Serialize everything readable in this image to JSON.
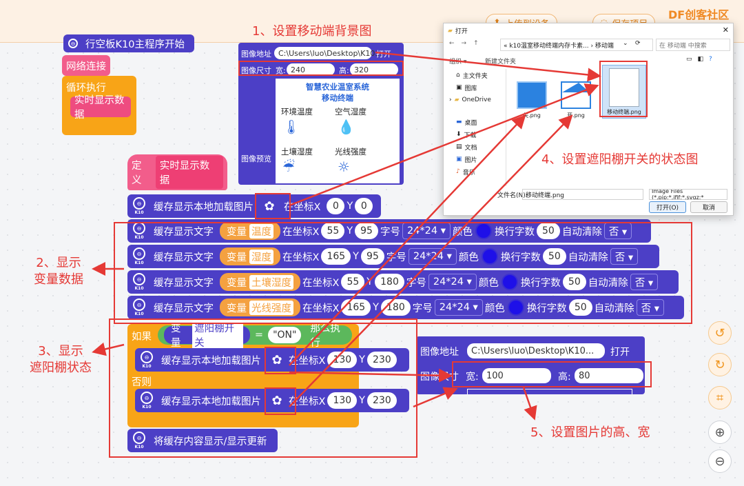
{
  "top_bar": {
    "button_1": "上传到设备",
    "button_2": "保存项目",
    "logo": "DF创客社区"
  },
  "blocks_top": {
    "start_block": "行空板K10主程序开始",
    "network": "网络连接",
    "loop": "循环执行",
    "call_fn": "实时显示数据"
  },
  "define_block": {
    "label": "定义",
    "name": "实时显示数据"
  },
  "load_image_block": {
    "text": "缓存显示本地加载图片",
    "at": "在坐标X",
    "x": "0",
    "y_label": "Y",
    "y": "0"
  },
  "text_blocks": [
    {
      "text": "缓存显示文字",
      "var_label": "变量",
      "var_name": "温度",
      "at": "在坐标X",
      "x": "55",
      "y_label": "Y",
      "y": "95",
      "size_label": "字号",
      "size": "24*24 ▾",
      "color_label": "颜色",
      "wrap_label": "换行字数",
      "wrap": "50",
      "clear_label": "自动清除",
      "clear": "否 ▾"
    },
    {
      "text": "缓存显示文字",
      "var_label": "变量",
      "var_name": "湿度",
      "at": "在坐标X",
      "x": "165",
      "y_label": "Y",
      "y": "95",
      "size_label": "字号",
      "size": "24*24 ▾",
      "color_label": "颜色",
      "wrap_label": "换行字数",
      "wrap": "50",
      "clear_label": "自动清除",
      "clear": "否 ▾"
    },
    {
      "text": "缓存显示文字",
      "var_label": "变量",
      "var_name": "土壤湿度",
      "at": "在坐标X",
      "x": "55",
      "y_label": "Y",
      "y": "180",
      "size_label": "字号",
      "size": "24*24 ▾",
      "color_label": "颜色",
      "wrap_label": "换行字数",
      "wrap": "50",
      "clear_label": "自动清除",
      "clear": "否 ▾"
    },
    {
      "text": "缓存显示文字",
      "var_label": "变量",
      "var_name": "光线强度",
      "at": "在坐标X",
      "x": "165",
      "y_label": "Y",
      "y": "180",
      "size_label": "字号",
      "size": "24*24 ▾",
      "color_label": "颜色",
      "wrap_label": "换行字数",
      "wrap": "50",
      "clear_label": "自动清除",
      "clear": "否 ▾"
    }
  ],
  "if_block": {
    "if_label": "如果",
    "var_label": "变量",
    "var_name": "遮阳棚开关",
    "op": "=",
    "value": "\"ON\"",
    "then_label": "那么执行",
    "else_label": "否则",
    "load_text": "缓存显示本地加载图片",
    "at": "在坐标X",
    "x": "130",
    "y_label": "Y",
    "y": "230",
    "refresh": "将缓存内容显示/显示更新"
  },
  "panel_top": {
    "path_label": "图像地址",
    "path": "C:\\Users\\luo\\Desktop\\K10...",
    "open": "打开",
    "size_label": "图像尺寸",
    "w_label": "宽:",
    "w": "240",
    "h_label": "高:",
    "h": "320",
    "preview_label": "图像预览",
    "preview_title": "智慧农业温室系统",
    "preview_sub": "移动终端",
    "items": [
      "环境温度",
      "空气湿度",
      "土壤湿度",
      "光线强度"
    ]
  },
  "panel_bottom": {
    "path_label": "图像地址",
    "path": "C:\\Users\\luo\\Desktop\\K10...",
    "open": "打开",
    "size_label": "图像尺寸",
    "w_label": "宽:",
    "w": "100",
    "h_label": "高:",
    "h": "80"
  },
  "dialog": {
    "title": "打开",
    "breadcrumb": "« k10温室移动终端内存卡素... › 移动端",
    "search_placeholder": "在 移动端 中搜索",
    "organize": "组织 ▾",
    "new_folder": "新建文件夹",
    "nav": [
      "主文件夹",
      "图库",
      "OneDrive",
      "桌面",
      "下载",
      "文档",
      "图片",
      "音乐"
    ],
    "files": [
      "关.png",
      "开.png",
      "移动终端.png"
    ],
    "filename_label": "文件名(N):",
    "filename": "移动终端.png",
    "filter": "Image Files (*.pjp;*.jfif;*.svgz;*",
    "open_btn": "打开(O)",
    "cancel_btn": "取消"
  },
  "annotations": {
    "a1": "1、设置移动端背景图",
    "a2_line1": "2、显示",
    "a2_line2": "变量数据",
    "a3_line1": "3、显示",
    "a3_line2": "遮阳棚状态",
    "a4": "4、设置遮阳棚开关的状态图",
    "a5": "5、设置图片的高、宽"
  },
  "colors": {
    "block": "#4c3fc6",
    "annotation": "#e53935",
    "variable": "#f4a140",
    "pink": "#f25d8b",
    "orange": "#f8a417",
    "green": "#5cb85c"
  }
}
